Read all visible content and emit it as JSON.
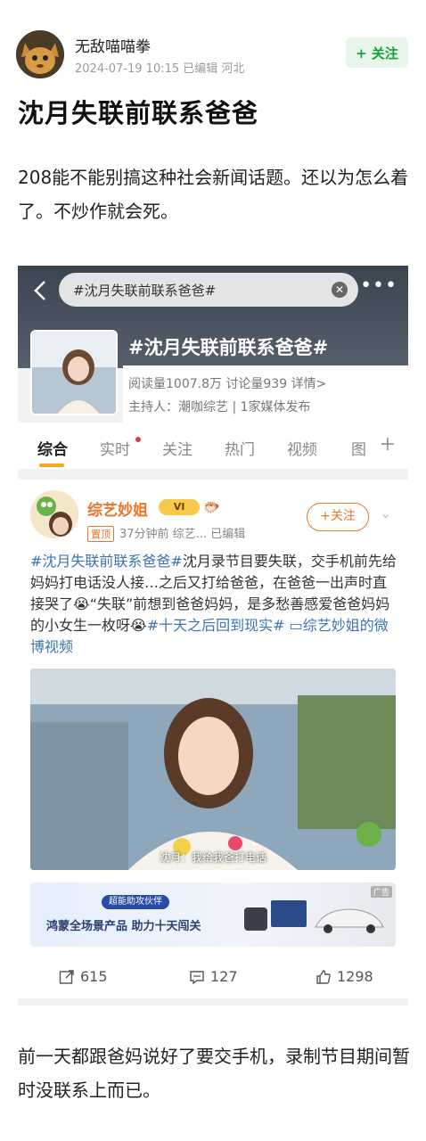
{
  "post": {
    "author": "无敌喵喵拳",
    "meta": "2024-07-19 10:15 已编辑 河北",
    "follow_label": "+ 关注",
    "title": "沈月失联前联系爸爸",
    "body": "208能不能别搞这种社会新闻话题。还以为怎么着了。不炒作就会死。",
    "footer": "前一天都跟爸妈说好了要交手机，录制节目期间暂时没联系上而已。"
  },
  "embed": {
    "search_text": "#沈月失联前联系爸爸#",
    "topic_title": "#沈月失联前联系爸爸#",
    "topic_stats": "阅读量1007.8万  讨论量939  详情>",
    "topic_host": "主持人：潮咖综艺 | 1家媒体发布",
    "tabs": [
      "综合",
      "实时",
      "关注",
      "热门",
      "视频",
      "图"
    ],
    "tab_plus": "+",
    "card": {
      "name": "综艺妙姐",
      "vip": "VI",
      "emoji": "🐡",
      "pin": "置顶",
      "meta": "37分钟前  综艺...  已编辑",
      "follow": "+关注",
      "chevron": "⌄",
      "text_tag1": "#沈月失联前联系爸爸#",
      "text_1": "沈月录节目要失联，交手机前先给妈妈打电话没人接…之后又打给爸爸，在爸爸一出声时直接哭了😭“失联”前想到爸爸妈妈，是多愁善感爱爸爸妈妈的小女生一枚呀😭",
      "text_tag2": "#十天之后回到现实#",
      "text_tag3": " ▭综艺妙姐的微博视频",
      "video_caption": "沈月：我给我爸打电话",
      "ad_pill": "超能助攻伙伴",
      "ad_text": "鸿蒙全场景产品  助力十天闯关",
      "ad_label": "广告",
      "repost": "615",
      "comment": "127",
      "like": "1298"
    }
  },
  "colors": {
    "accent_green": "#1a9e3a",
    "accent_orange": "#e8752a",
    "tag_blue": "#3c73b4"
  }
}
